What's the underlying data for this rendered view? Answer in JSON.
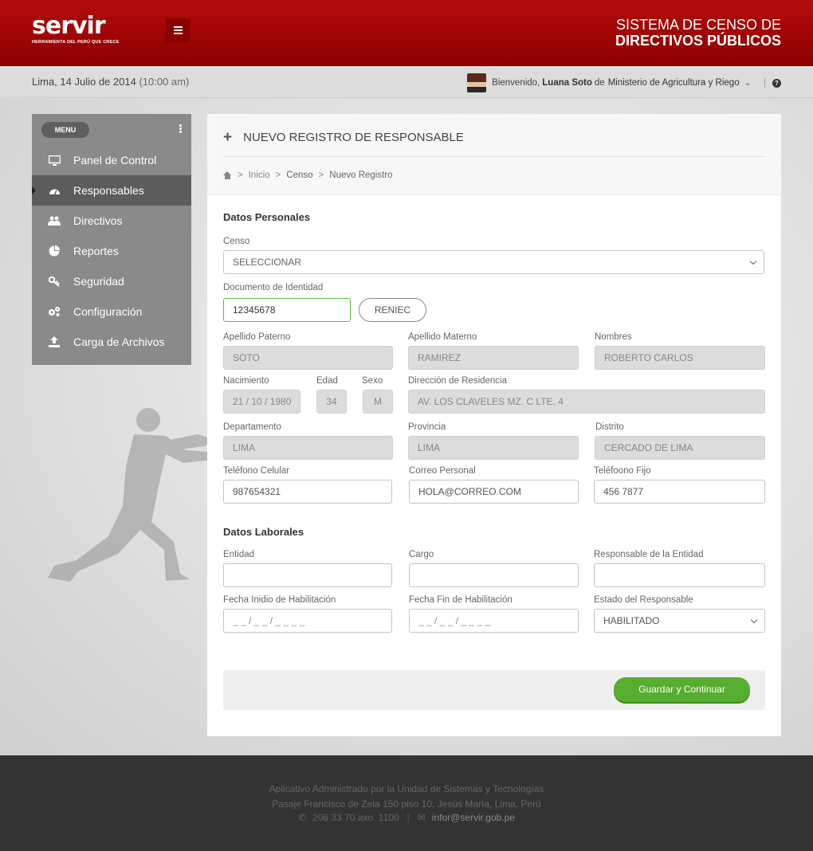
{
  "header": {
    "logo_text": "servir",
    "logo_tagline": "HERRAMIENTA DEL PERÚ QUE CRECE",
    "system_title_line1": "SISTEMA DE CENSO  DE",
    "system_title_line2": "DIRECTIVOS PÚBLICOS"
  },
  "infobar": {
    "date": "Lima, 14 Julio de 2014",
    "time": "(10:00 am)",
    "welcome": "Bienvenido,",
    "user_name": "Luana Soto",
    "de": "de",
    "entity": "Ministerio de Agricultura y Riego",
    "help": "?"
  },
  "sidebar": {
    "menu_label": "MENU",
    "items": [
      {
        "label": "Panel de Control",
        "icon": "monitor-icon"
      },
      {
        "label": "Responsables",
        "icon": "dashboard-icon",
        "active": true
      },
      {
        "label": "Directivos",
        "icon": "users-icon"
      },
      {
        "label": "Reportes",
        "icon": "pie-chart-icon"
      },
      {
        "label": "Seguridad",
        "icon": "key-icon"
      },
      {
        "label": "Configuración",
        "icon": "gears-icon"
      },
      {
        "label": "Carga de Archivos",
        "icon": "upload-icon"
      }
    ]
  },
  "panel": {
    "title": "NUEVO REGISTRO DE RESPONSABLE",
    "breadcrumb": [
      "Inicio",
      "Censo",
      "Nuevo Registro"
    ],
    "personal": {
      "section_title": "Datos Personales",
      "censo_label": "Censo",
      "censo_value": "SELECCIONAR",
      "doc_label": "Documento de Identidad",
      "doc_value": "12345678",
      "reniec_button": "RENIEC",
      "ap_paterno_label": "Apellido Paterno",
      "ap_paterno_value": "SOTO",
      "ap_materno_label": "Apellido Materno",
      "ap_materno_value": "RAMIREZ",
      "nombres_label": "Nombres",
      "nombres_value": "ROBERTO CARLOS",
      "nacimiento_label": "Nacimiento",
      "nacimiento_value": "21 / 10 / 1980",
      "edad_label": "Edad",
      "edad_value": "34",
      "sexo_label": "Sexo",
      "sexo_value": "M",
      "direccion_label": "Dirección de Residencia",
      "direccion_value": "AV. LOS CLAVELES MZ. C LTE. 4",
      "departamento_label": "Departamento",
      "departamento_value": "LIMA",
      "provincia_label": "Provincia",
      "provincia_value": "LIMA",
      "distrito_label": "Distrito",
      "distrito_value": "CERCADO DE LIMA",
      "celular_label": "Teléfono Celular",
      "celular_value": "987654321",
      "correo_label": "Correo Personal",
      "correo_value": "HOLA@CORREO.COM",
      "fijo_label": "Teléfoono Fijo",
      "fijo_value": "456 7877"
    },
    "laboral": {
      "section_title": "Datos Laborales",
      "entidad_label": "Entidad",
      "entidad_value": "",
      "cargo_label": "Cargo",
      "cargo_value": "",
      "responsable_label": "Responsable de la Entidad",
      "responsable_value": "",
      "fecha_inicio_label": "Fecha Inidio de Habilitación",
      "fecha_inicio_placeholder": "_ _ / _ _ / _ _ _ _",
      "fecha_fin_label": "Fecha Fin de Habilitación",
      "fecha_fin_placeholder": "_ _ / _ _ / _ _ _ _",
      "estado_label": "Estado del Responsable",
      "estado_value": "HABILITADO"
    },
    "save_button": "Guardar y Continuar"
  },
  "footer": {
    "line1": "Aplicativo Administrado por la Unidad de Sistemas y Tecnologías",
    "line2": "Pasaje Francisco de Zela 150 piso 10, Jesús María, Lima, Perú",
    "phone": "206 33 70 axo. 1100",
    "email": "infor@servir.gob.pe"
  },
  "colors": {
    "header_red": "#a30606",
    "accent_green": "#57ad2f",
    "sidebar_gray": "#8a8a8a",
    "sidebar_active": "#5c5c5c",
    "footer_dark": "#333333"
  }
}
